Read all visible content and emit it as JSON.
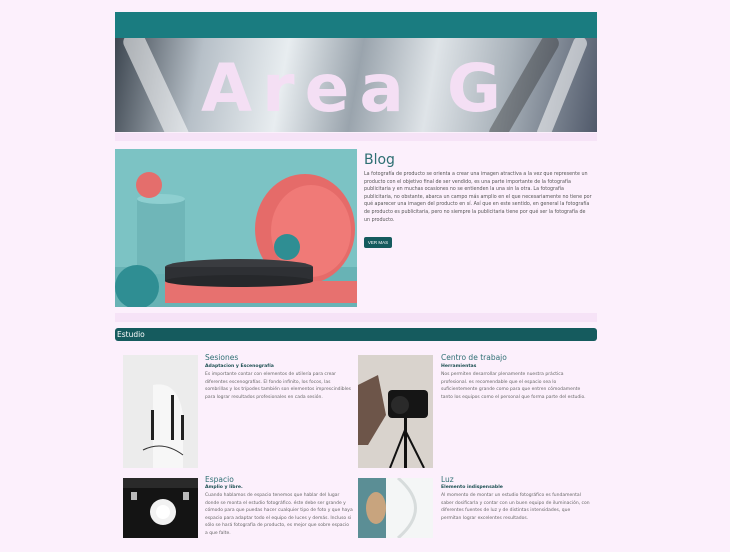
{
  "hero": {
    "title": "Area G"
  },
  "blog": {
    "title": "Blog",
    "text": "La fotografía de producto se orienta a crear una imagen atractiva a la vez que represente un producto con el objetivo final de ser vendido, es una parte importante de la fotografía publicitaria y en muchas ocasiones no se entienden la una sin la otra. La fotografía publicitaria, no obstante, abarca un campo más amplio en el que necesariamente no tiene por qué aparecer una imagen del producto en sí. Así que en este sentido, en general la fotografía de producto es publicitaria, pero no siempre la publicitaria tiene por qué ser la fotografía de un producto.",
    "button": "VER MAS"
  },
  "study": {
    "label": "Estudio",
    "cards": [
      {
        "title": "Sesiones",
        "subtitle": "Adaptacion y Escenografía",
        "text": "Es importante contar con elementos de utilería para crear diferentes escenografías. El fondo infinito, los focos, las sombrillas y los trípodes también son elementos imprescindibles para lograr resultados profesionales en cada sesión."
      },
      {
        "title": "Centro de trabajo",
        "subtitle": "Herramientas",
        "text": "Nos permiten desarrollar plenamente nuestra práctica profesional. es recomendable que el espacio sea lo suficientemente grande como para que entren cómodamente tanto los equipos como el personal que forma parte del estudio."
      },
      {
        "title": "Espacio",
        "subtitle": "Amplio y libre.",
        "text": "Cuando hablamos de espacio tenemos que hablar del lugar donde se monta el estudio fotográfico. éste debe ser grande y cómodo para que puedas hacer cualquier tipo de foto y que haya espacio para adaptar todo el equipo de luces y demás. Incluso si sólo se hará fotografía de producto, es mejor que sobre espacio a que falte."
      },
      {
        "title": "Luz",
        "subtitle": "Elemento indispensable",
        "text": "Al momento de montar un estudio fotográfico es fundamental saber dosificarla y contar con un buen equipo de iluminación, con diferentes fuentes de luz y de distintas intensidades, que permitan lograr excelentes resultados."
      }
    ]
  }
}
